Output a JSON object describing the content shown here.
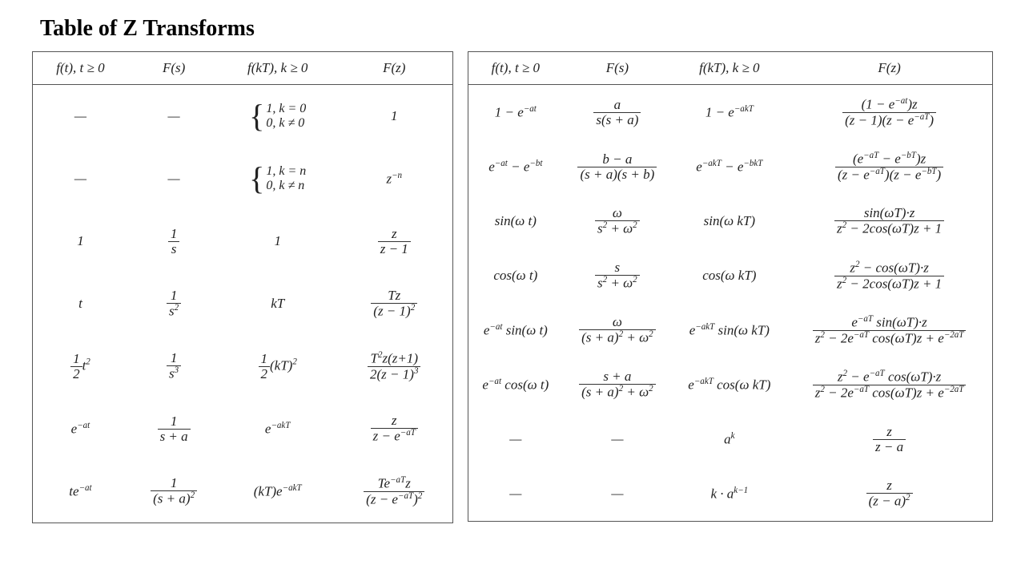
{
  "title": "Table of Z Transforms",
  "headers": {
    "c1": "f(t), t ≥ 0",
    "c2": "F(s)",
    "c3": "f(kT), k ≥ 0",
    "c4": "F(z)"
  },
  "chart_data": {
    "type": "table",
    "title": "Table of Z Transforms",
    "columns": [
      "f(t), t≥0",
      "F(s)",
      "f(kT), k≥0",
      "F(z)"
    ],
    "left_rows": [
      [
        "—",
        "—",
        "{1, k=0; 0, k≠0}",
        "1"
      ],
      [
        "—",
        "—",
        "{1, k=n; 0, k≠n}",
        "z^{-n}"
      ],
      [
        "1",
        "1/s",
        "1",
        "z/(z−1)"
      ],
      [
        "t",
        "1/s^2",
        "kT",
        "T z / (z−1)^2"
      ],
      [
        "(1/2) t^2",
        "1/s^3",
        "(1/2)(kT)^2",
        "T^2 z (z+1) / (2(z−1)^3)"
      ],
      [
        "e^{-at}",
        "1/(s+a)",
        "e^{-akT}",
        "z / (z − e^{-aT})"
      ],
      [
        "t e^{-at}",
        "1/(s+a)^2",
        "(kT) e^{-akT}",
        "T e^{-aT} z / (z − e^{-aT})^2"
      ]
    ],
    "right_rows": [
      [
        "1 − e^{-at}",
        "a / (s(s+a))",
        "1 − e^{-akT}",
        "(1 − e^{-at}) z / ((z−1)(z − e^{-aT}))"
      ],
      [
        "e^{-at} − e^{-bt}",
        "(b−a)/((s+a)(s+b))",
        "e^{-akT} − e^{-bkT}",
        "(e^{-aT} − e^{-bT}) z / ((z − e^{-aT})(z − e^{-bT}))"
      ],
      [
        "sin(ωt)",
        "ω/(s^2+ω^2)",
        "sin(ωkT)",
        "sin(ωT)·z / (z^2 − 2cos(ωT)z + 1)"
      ],
      [
        "cos(ωt)",
        "s/(s^2+ω^2)",
        "cos(ωkT)",
        "(z^2 − cos(ωT)·z)/(z^2 − 2cos(ωT)z + 1)"
      ],
      [
        "e^{-at} sin(ωt)",
        "ω/((s+a)^2+ω^2)",
        "e^{-akT} sin(ωkT)",
        "e^{-aT} sin(ωT)·z / (z^2 − 2e^{-aT}cos(ωT)z + e^{-2aT})"
      ],
      [
        "e^{-at} cos(ωt)",
        "(s+a)/((s+a)^2+ω^2)",
        "e^{-akT} cos(ωkT)",
        "(z^2 − e^{-aT}cos(ωT)·z)/(z^2 − 2e^{-aT}cos(ωT)z + e^{-2aT})"
      ],
      [
        "—",
        "—",
        "a^k",
        "z/(z−a)"
      ],
      [
        "—",
        "—",
        "k·a^{k−1}",
        "z/(z−a)^2"
      ]
    ]
  },
  "sym": {
    "dash": "—",
    "one": "1",
    "t": "t",
    "kT": "kT",
    "s": "s",
    "z": "z",
    "a": "a",
    "omega": "ω",
    "zm1": "z − 1",
    "T": "T",
    "Tz": "Tz",
    "splusa": "s + a",
    "b_minus_a": "b − a",
    "k0": "1, k = 0",
    "kne0": "0, k ≠ 0",
    "kn": "1, k = n",
    "knn": "0, k ≠ n",
    "exp_mat": "e",
    "exp_mat_sup_at": "−at",
    "exp_mat_sup_bt": "−bt",
    "exp_mat_sup_akT": "−akT",
    "exp_mat_sup_bkT": "−bkT",
    "exp_mat_sup_aT": "−aT",
    "exp_mat_sup_bT": "−bT",
    "exp_mat_sup_2aT": "−2aT",
    "kTparen": "(kT)e",
    "half": "2",
    "t2": "t",
    "kTsq": "(kT)",
    "T2": "T",
    "zp1": "z(z+1)",
    "two_zm1_3": "2(z − 1)",
    "splusa_sq": "(s + a)",
    "z_minus_eaT": "z − e",
    "Te": "Te",
    "one_minus_eat": "1 − e",
    "num_r1": "(1 − e",
    "num_r1_tail": ")z",
    "den_r1": "(z − 1)(z − e",
    "num_r2": "(e",
    "minus": " − e",
    "tail_z": ")z",
    "den_r2": "(z − e",
    "close_paren": ")",
    "sin": "sin(ω t)",
    "sin_kT": "sin(ω kT)",
    "cos": "cos(ω t)",
    "cos_kT": "cos(ω kT)",
    "s2w2": "s",
    "plusw2": " + ω",
    "sinwTz": "sin(ωT)·z",
    "coswTz": "cos(ωT)·z",
    "z2": "z",
    "m2coswT": " − 2cos(ωT)z + 1",
    "m2ecoswT": " − 2e",
    "coswTtail": " cos(ωT)z + e",
    "ak": "a",
    "k": "k",
    "km1": "k−1",
    "k_dot_a": "k · a",
    "zma": "z − a",
    "zma2": "(z − a)",
    "e_sin": " sin(ω t)",
    "e_cos": " cos(ω t)",
    "e_sin_kT": " sin(ω kT)",
    "e_cos_kT": " cos(ω kT)",
    "e_sinwTz": " sin(ωT)·z",
    "e_coswTz": " cos(ωT)·z",
    "z2_minus": "z",
    "sq": "2",
    "cube": "3",
    "neg_n": "−n",
    "s_sup2": "2",
    "s_sup3": "3"
  }
}
